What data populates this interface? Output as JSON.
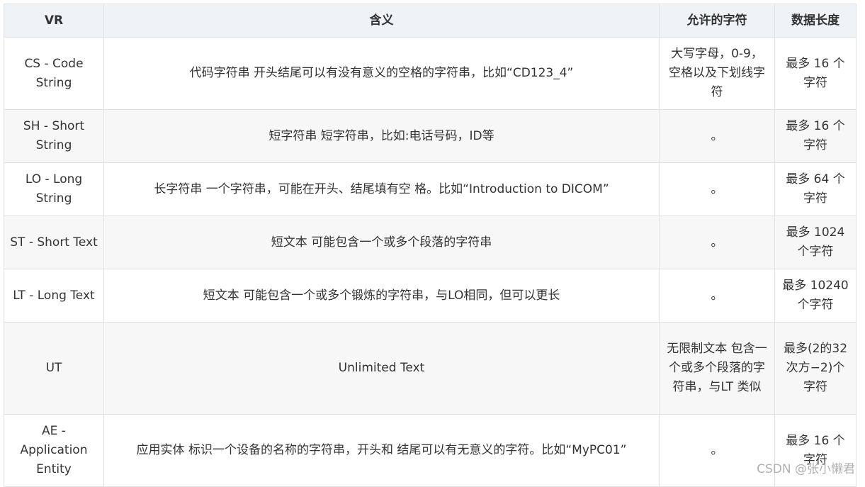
{
  "table": {
    "headers": {
      "vr": "VR",
      "meaning": "含义",
      "allowed_chars": "允许的字符",
      "data_length": "数据长度"
    },
    "rows": [
      {
        "vr": "CS - Code String",
        "meaning": "代码字符串 开头结尾可以有没有意义的空格的字符串，比如“CD123_4”",
        "allowed_chars": "大写字母，0-9，空格以及下划线字符",
        "data_length": "最多 16 个字符"
      },
      {
        "vr": "SH - Short String",
        "meaning": "短字符串 短字符串，比如:电话号码，ID等",
        "allowed_chars": "。",
        "data_length": "最多 16 个字符"
      },
      {
        "vr": "LO - Long String",
        "meaning": "长字符串 一个字符串，可能在开头、结尾填有空 格。比如“Introduction to DICOM”",
        "allowed_chars": "。",
        "data_length": "最多 64 个字符"
      },
      {
        "vr": "ST - Short Text",
        "meaning": "短文本 可能包含一个或多个段落的字符串",
        "allowed_chars": "。",
        "data_length": "最多 1024 个字符"
      },
      {
        "vr": "LT - Long Text",
        "meaning": "短文本 可能包含一个或多个锻炼的字符串，与LO相同，但可以更长",
        "allowed_chars": "。",
        "data_length": "最多 10240 个字符"
      },
      {
        "vr": "UT",
        "meaning": "Unlimited Text",
        "allowed_chars": "无限制文本 包含一个或多个段落的字符串，与LT 类似",
        "data_length": "最多(2的32次方−2)个字符"
      },
      {
        "vr": "AE - Application Entity",
        "meaning": "应用实体 标识一个设备的名称的字符串，开头和 结尾可以有无意义的字符。比如“MyPC01”",
        "allowed_chars": "。",
        "data_length": "最多 16 个字符"
      }
    ]
  },
  "watermark": "CSDN @张小懒君"
}
